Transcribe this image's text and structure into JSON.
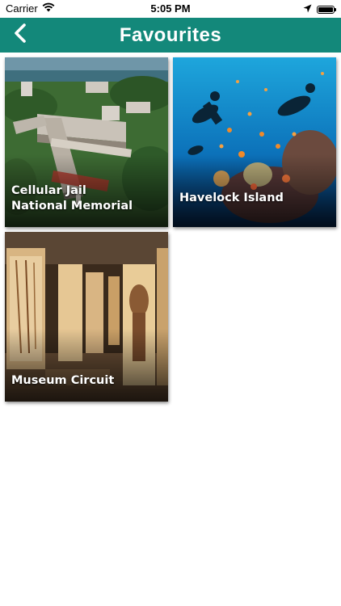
{
  "status_bar": {
    "carrier": "Carrier",
    "time": "5:05 PM",
    "battery_level": 1.0
  },
  "header": {
    "back_icon": "chevron-left-icon",
    "title": "Favourites"
  },
  "favourites": [
    {
      "line1": "Cellular Jail",
      "line2": "National Memorial"
    },
    {
      "line1": "Havelock Island",
      "line2": ""
    },
    {
      "line1": "Museum Circuit",
      "line2": ""
    }
  ],
  "colors": {
    "accent": "#13887a",
    "status_text": "#000000",
    "background": "#ffffff"
  }
}
